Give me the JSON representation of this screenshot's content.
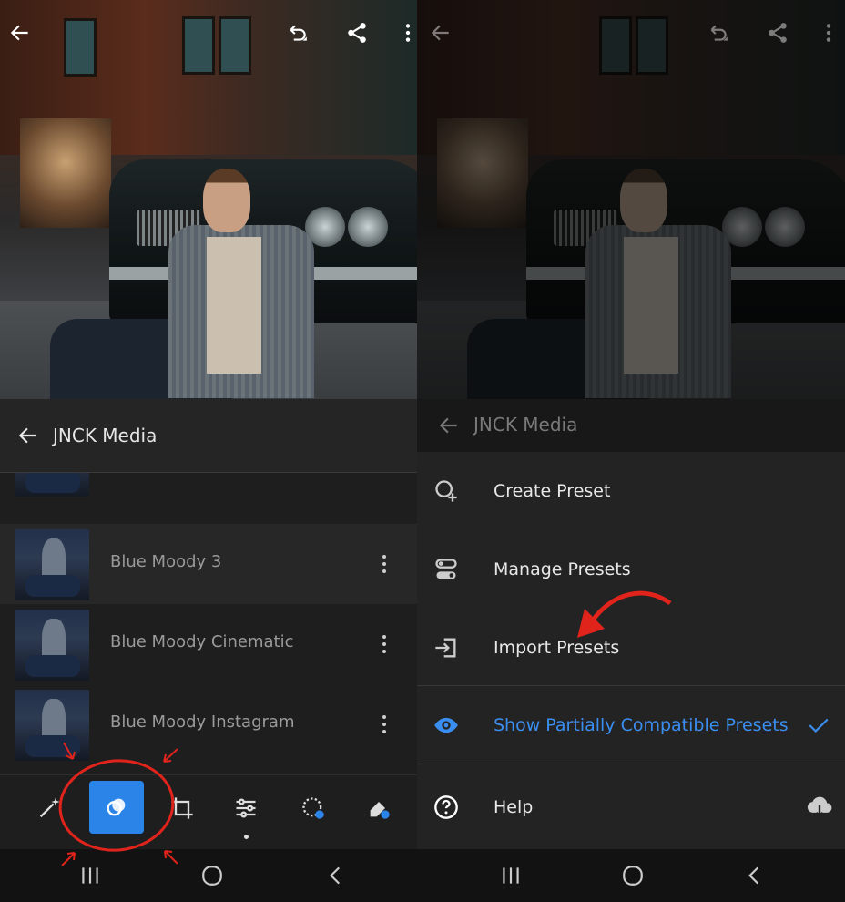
{
  "left_panel": {
    "header": {
      "title": "JNCK Media"
    },
    "presets": [
      {
        "label": "Blue Moody 3"
      },
      {
        "label": "Blue Moody Cinematic"
      },
      {
        "label": "Blue Moody Instagram"
      }
    ],
    "toolbar": {
      "tools": [
        "auto-enhance-icon",
        "presets-icon",
        "crop-icon",
        "adjust-sliders-icon",
        "masking-icon",
        "healing-icon"
      ],
      "active": "presets-icon"
    }
  },
  "right_panel": {
    "header": {
      "title": "JNCK Media"
    },
    "menu": [
      {
        "label": "Create Preset",
        "icon": "create-preset-icon"
      },
      {
        "label": "Manage Presets",
        "icon": "manage-presets-icon"
      },
      {
        "label": "Import Presets",
        "icon": "import-icon"
      },
      {
        "label": "Show Partially Compatible Presets",
        "icon": "eye-icon",
        "checked": true
      },
      {
        "label": "Help",
        "icon": "help-icon"
      }
    ]
  },
  "colors": {
    "accent": "#2b84e8",
    "annotation": "#e0241c"
  }
}
